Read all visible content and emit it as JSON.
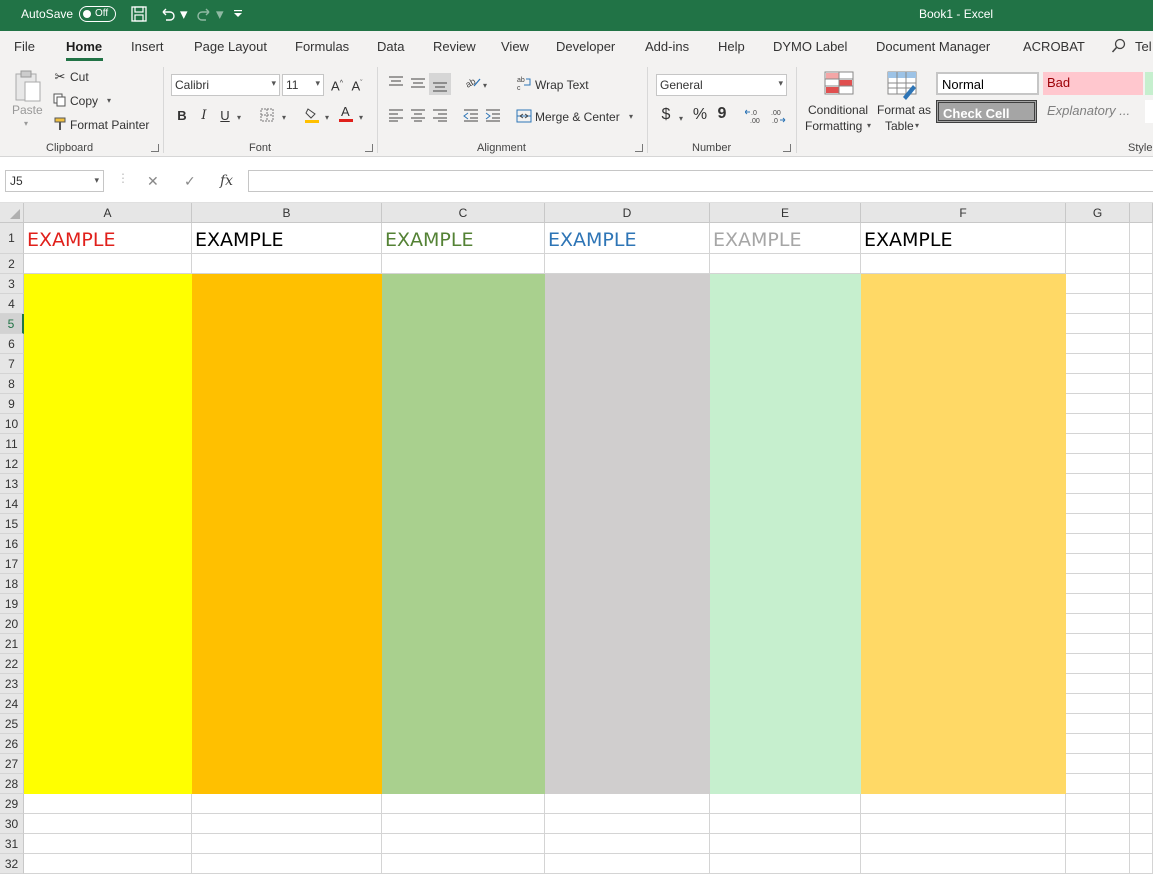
{
  "titlebar": {
    "autosave_label": "AutoSave",
    "autosave_state": "Off",
    "title": "Book1  -  Excel",
    "icons": [
      "save-icon",
      "undo-icon",
      "redo-icon",
      "customize-qat-icon"
    ]
  },
  "tabs": [
    "File",
    "Home",
    "Insert",
    "Page Layout",
    "Formulas",
    "Data",
    "Review",
    "View",
    "Developer",
    "Add-ins",
    "Help",
    "DYMO Label",
    "Document Manager",
    "ACROBAT",
    "Tel"
  ],
  "active_tab": "Home",
  "ribbon": {
    "clipboard": {
      "label": "Clipboard",
      "paste": "Paste",
      "cut": "Cut",
      "copy": "Copy",
      "format_painter": "Format Painter"
    },
    "font": {
      "label": "Font",
      "font_name": "Calibri",
      "font_size": "11",
      "bold": "B",
      "italic": "I",
      "underline": "U"
    },
    "alignment": {
      "label": "Alignment",
      "wrap_text": "Wrap Text",
      "merge_center": "Merge & Center"
    },
    "number": {
      "label": "Number",
      "format": "General",
      "currency": "$",
      "percent": "%",
      "comma": "9",
      "inc_decimal": "←.0 .00",
      "dec_decimal": ".00 →.0"
    },
    "conditional_formatting": {
      "line1": "Conditional",
      "line2": "Formatting"
    },
    "format_as_table": {
      "line1": "Format as",
      "line2": "Table"
    },
    "styles": {
      "label": "Style",
      "normal": "Normal",
      "bad": "Bad",
      "check_cell": "Check Cell",
      "explanatory": "Explanatory ..."
    }
  },
  "formula_bar": {
    "name_box": "J5",
    "cancel": "✕",
    "enter": "✓",
    "fx": "fx",
    "formula": ""
  },
  "columns": [
    "A",
    "B",
    "C",
    "D",
    "E",
    "F",
    "G"
  ],
  "rows": [
    "1",
    "2",
    "3",
    "4",
    "5",
    "6",
    "7",
    "8",
    "9",
    "10",
    "11",
    "12",
    "13",
    "14",
    "15",
    "16",
    "17",
    "18",
    "19",
    "20",
    "21",
    "22",
    "23",
    "24",
    "25",
    "26",
    "27",
    "28",
    "29",
    "30",
    "31",
    "32"
  ],
  "selected_row": "5",
  "cells": {
    "A1": {
      "text": "EXAMPLE",
      "color": "#e0201b"
    },
    "B1": {
      "text": "EXAMPLE",
      "color": "#000000"
    },
    "C1": {
      "text": "EXAMPLE",
      "color": "#548235"
    },
    "D1": {
      "text": "EXAMPLE",
      "color": "#2e75b6"
    },
    "E1": {
      "text": "EXAMPLE",
      "color": "#a6a6a6"
    },
    "F1": {
      "text": "EXAMPLE",
      "color": "#000000"
    }
  },
  "fills": {
    "A": "#ffff00",
    "B": "#ffc000",
    "C": "#a9d08e",
    "D": "#d0cece",
    "E": "#c6efce",
    "F": "#ffd966"
  },
  "fill_rows": [
    "3",
    "28"
  ]
}
